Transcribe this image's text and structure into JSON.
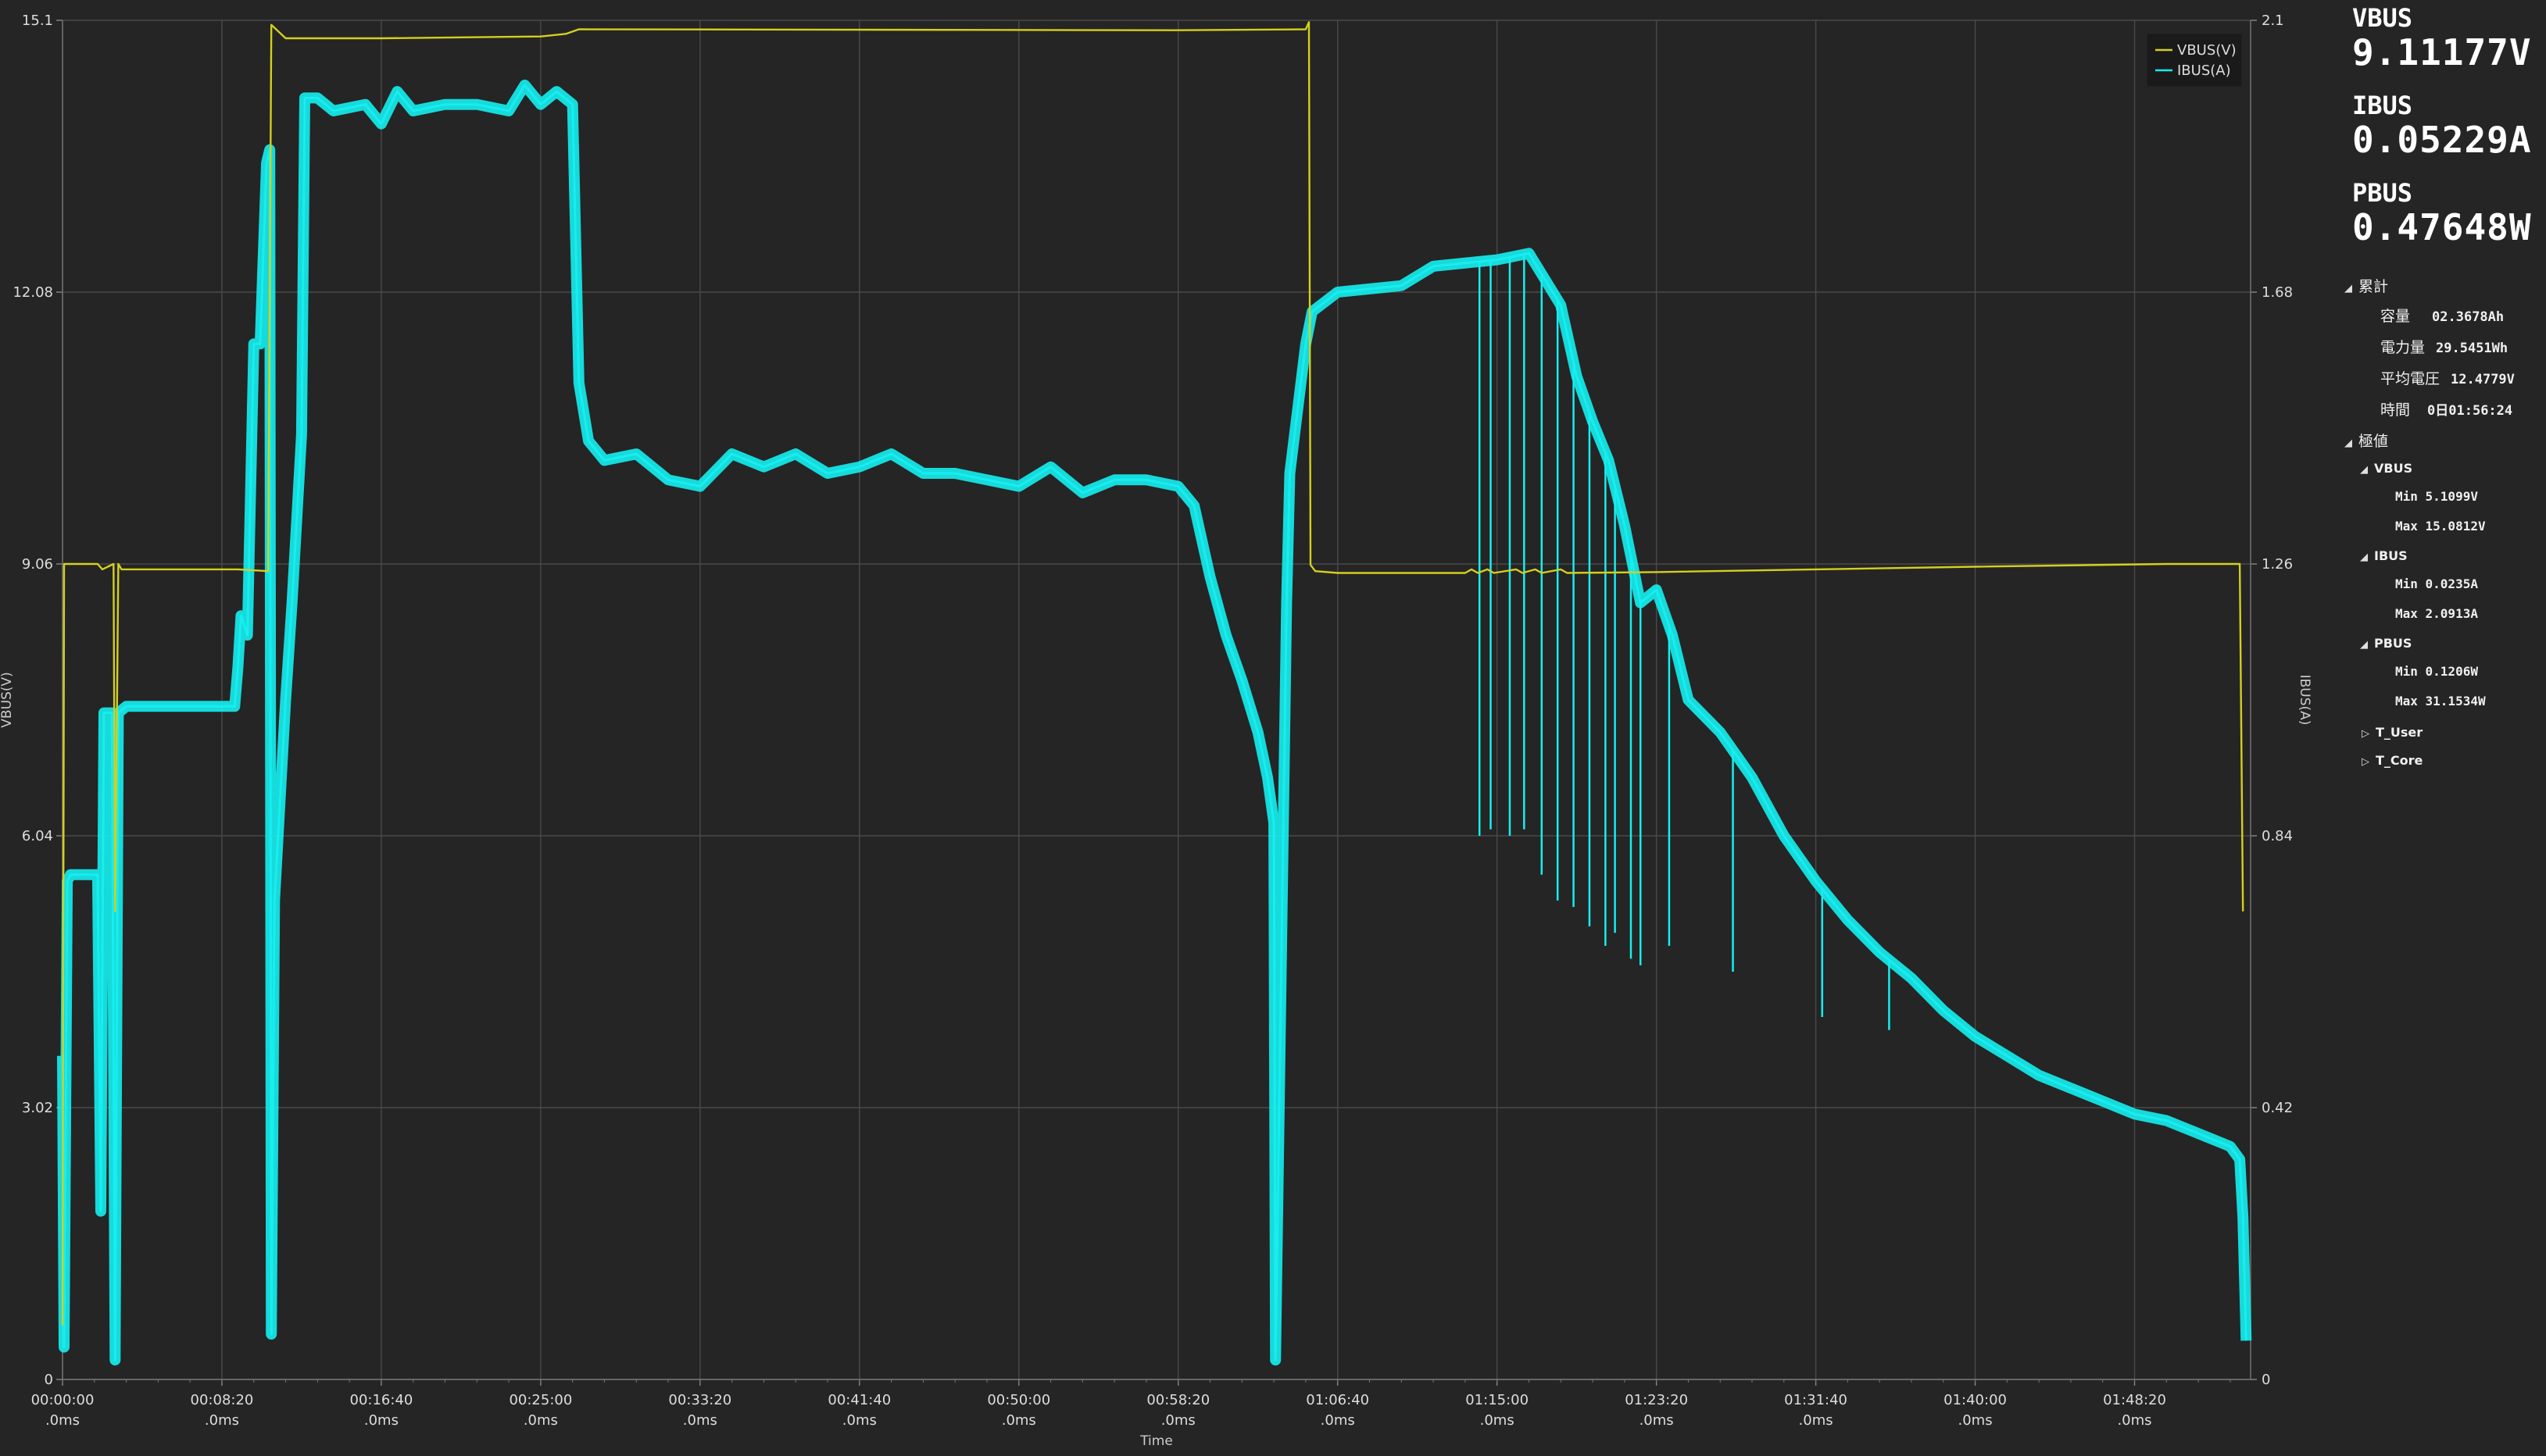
{
  "chart_data": {
    "type": "line",
    "xlabel": "Time",
    "ylabel_left": "VBUS(V)",
    "ylabel_right": "IBUS(A)",
    "x_unit": "seconds",
    "xlim_seconds": [
      0,
      6864
    ],
    "x_ticks": [
      {
        "t": 0,
        "label": "00:00:00",
        "sub": ".0ms"
      },
      {
        "t": 500,
        "label": "00:08:20",
        "sub": ".0ms"
      },
      {
        "t": 1000,
        "label": "00:16:40",
        "sub": ".0ms"
      },
      {
        "t": 1500,
        "label": "00:25:00",
        "sub": ".0ms"
      },
      {
        "t": 2000,
        "label": "00:33:20",
        "sub": ".0ms"
      },
      {
        "t": 2500,
        "label": "00:41:40",
        "sub": ".0ms"
      },
      {
        "t": 3000,
        "label": "00:50:00",
        "sub": ".0ms"
      },
      {
        "t": 3500,
        "label": "00:58:20",
        "sub": ".0ms"
      },
      {
        "t": 4000,
        "label": "01:06:40",
        "sub": ".0ms"
      },
      {
        "t": 4500,
        "label": "01:15:00",
        "sub": ".0ms"
      },
      {
        "t": 5000,
        "label": "01:23:20",
        "sub": ".0ms"
      },
      {
        "t": 5500,
        "label": "01:31:40",
        "sub": ".0ms"
      },
      {
        "t": 6000,
        "label": "01:40:00",
        "sub": ".0ms"
      },
      {
        "t": 6500,
        "label": "01:48:20",
        "sub": ".0ms"
      }
    ],
    "ylim_left": [
      0,
      15.1
    ],
    "left_ticks": [
      "0",
      "3.02",
      "6.04",
      "9.06",
      "12.08",
      "15.1"
    ],
    "ylim_right": [
      0,
      2.1
    ],
    "right_ticks": [
      "0",
      "0.42",
      "0.84",
      "1.26",
      "1.68",
      "2.1"
    ],
    "grid": true,
    "legend_position": "top-right",
    "series": [
      {
        "name": "VBUS(V)",
        "axis": "left",
        "color": "#d4cf1e",
        "points": [
          [
            0,
            0.6
          ],
          [
            5,
            9.06
          ],
          [
            110,
            9.06
          ],
          [
            125,
            9.0
          ],
          [
            160,
            9.06
          ],
          [
            165,
            5.2
          ],
          [
            175,
            9.06
          ],
          [
            185,
            9.0
          ],
          [
            550,
            9.0
          ],
          [
            645,
            8.98
          ],
          [
            655,
            15.05
          ],
          [
            700,
            14.9
          ],
          [
            1000,
            14.9
          ],
          [
            1500,
            14.92
          ],
          [
            1580,
            14.95
          ],
          [
            1620,
            15.0
          ],
          [
            3500,
            14.99
          ],
          [
            3900,
            15.0
          ],
          [
            3910,
            15.08
          ],
          [
            3915,
            9.05
          ],
          [
            3930,
            8.98
          ],
          [
            4000,
            8.96
          ],
          [
            4400,
            8.96
          ],
          [
            4420,
            9.0
          ],
          [
            4440,
            8.96
          ],
          [
            4470,
            9.0
          ],
          [
            4490,
            8.96
          ],
          [
            4560,
            9.0
          ],
          [
            4580,
            8.96
          ],
          [
            4620,
            9.0
          ],
          [
            4640,
            8.96
          ],
          [
            4700,
            9.0
          ],
          [
            4720,
            8.96
          ],
          [
            5000,
            8.97
          ],
          [
            5500,
            9.0
          ],
          [
            6000,
            9.03
          ],
          [
            6600,
            9.06
          ],
          [
            6830,
            9.06
          ],
          [
            6840,
            5.2
          ]
        ]
      },
      {
        "name": "IBUS(A)",
        "axis": "right",
        "color": "#16eef0",
        "points": [
          [
            0,
            0.5
          ],
          [
            5,
            0.05
          ],
          [
            15,
            0.77
          ],
          [
            25,
            0.78
          ],
          [
            110,
            0.78
          ],
          [
            120,
            0.26
          ],
          [
            130,
            1.03
          ],
          [
            155,
            1.03
          ],
          [
            165,
            0.03
          ],
          [
            175,
            1.03
          ],
          [
            200,
            1.04
          ],
          [
            540,
            1.04
          ],
          [
            550,
            1.1
          ],
          [
            560,
            1.18
          ],
          [
            580,
            1.15
          ],
          [
            600,
            1.6
          ],
          [
            620,
            1.6
          ],
          [
            640,
            1.88
          ],
          [
            650,
            1.9
          ],
          [
            655,
            0.07
          ],
          [
            665,
            0.74
          ],
          [
            700,
            1.05
          ],
          [
            720,
            1.2
          ],
          [
            750,
            1.46
          ],
          [
            760,
            1.98
          ],
          [
            800,
            1.98
          ],
          [
            850,
            1.96
          ],
          [
            950,
            1.97
          ],
          [
            1000,
            1.94
          ],
          [
            1050,
            1.99
          ],
          [
            1100,
            1.96
          ],
          [
            1200,
            1.97
          ],
          [
            1300,
            1.97
          ],
          [
            1400,
            1.96
          ],
          [
            1450,
            2.0
          ],
          [
            1500,
            1.97
          ],
          [
            1550,
            1.99
          ],
          [
            1600,
            1.97
          ],
          [
            1620,
            1.54
          ],
          [
            1650,
            1.45
          ],
          [
            1700,
            1.42
          ],
          [
            1800,
            1.43
          ],
          [
            1900,
            1.39
          ],
          [
            2000,
            1.38
          ],
          [
            2100,
            1.43
          ],
          [
            2200,
            1.41
          ],
          [
            2300,
            1.43
          ],
          [
            2400,
            1.4
          ],
          [
            2500,
            1.41
          ],
          [
            2600,
            1.43
          ],
          [
            2700,
            1.4
          ],
          [
            2800,
            1.4
          ],
          [
            2900,
            1.39
          ],
          [
            3000,
            1.38
          ],
          [
            3100,
            1.41
          ],
          [
            3200,
            1.37
          ],
          [
            3300,
            1.39
          ],
          [
            3400,
            1.39
          ],
          [
            3500,
            1.38
          ],
          [
            3550,
            1.35
          ],
          [
            3600,
            1.24
          ],
          [
            3650,
            1.15
          ],
          [
            3700,
            1.08
          ],
          [
            3750,
            1.0
          ],
          [
            3780,
            0.93
          ],
          [
            3800,
            0.86
          ],
          [
            3805,
            0.03
          ],
          [
            3840,
            1.2
          ],
          [
            3850,
            1.4
          ],
          [
            3900,
            1.6
          ],
          [
            3920,
            1.65
          ],
          [
            4000,
            1.68
          ],
          [
            4200,
            1.69
          ],
          [
            4300,
            1.72
          ],
          [
            4500,
            1.73
          ],
          [
            4600,
            1.74
          ],
          [
            4700,
            1.66
          ],
          [
            4750,
            1.55
          ],
          [
            4800,
            1.48
          ],
          [
            4850,
            1.42
          ],
          [
            4900,
            1.32
          ],
          [
            4950,
            1.2
          ],
          [
            5000,
            1.22
          ],
          [
            5050,
            1.15
          ],
          [
            5100,
            1.05
          ],
          [
            5200,
            1.0
          ],
          [
            5300,
            0.93
          ],
          [
            5400,
            0.84
          ],
          [
            5500,
            0.77
          ],
          [
            5600,
            0.71
          ],
          [
            5700,
            0.66
          ],
          [
            5800,
            0.62
          ],
          [
            5900,
            0.57
          ],
          [
            6000,
            0.53
          ],
          [
            6100,
            0.5
          ],
          [
            6200,
            0.47
          ],
          [
            6300,
            0.45
          ],
          [
            6400,
            0.43
          ],
          [
            6500,
            0.41
          ],
          [
            6600,
            0.4
          ],
          [
            6700,
            0.38
          ],
          [
            6800,
            0.36
          ],
          [
            6830,
            0.34
          ],
          [
            6840,
            0.25
          ],
          [
            6850,
            0.06
          ]
        ],
        "spikes": [
          [
            4445,
            0.84
          ],
          [
            4480,
            0.85
          ],
          [
            4540,
            0.84
          ],
          [
            4585,
            0.85
          ],
          [
            4640,
            0.78
          ],
          [
            4690,
            0.74
          ],
          [
            4740,
            0.73
          ],
          [
            4790,
            0.7
          ],
          [
            4840,
            0.67
          ],
          [
            4870,
            0.69
          ],
          [
            4920,
            0.65
          ],
          [
            4950,
            0.64
          ],
          [
            5040,
            0.67
          ],
          [
            5240,
            0.63
          ],
          [
            5520,
            0.56
          ],
          [
            5730,
            0.54
          ]
        ]
      }
    ]
  },
  "readouts": {
    "vbus_label": "VBUS",
    "vbus_value": "9.11177V",
    "ibus_label": "IBUS",
    "ibus_value": "0.05229A",
    "pbus_label": "PBUS",
    "pbus_value": "0.47648W"
  },
  "tree": {
    "cumulative_label": "累計",
    "capacity_label": "容量",
    "capacity_value": "02.3678Ah",
    "energy_label": "電力量",
    "energy_value": "29.5451Wh",
    "avg_voltage_label": "平均電圧",
    "avg_voltage_value": "12.4779V",
    "time_label": "時間",
    "time_value": "0日01:56:24",
    "extremes_label": "極値",
    "vbus_group": "VBUS",
    "vbus_min": "Min 5.1099V",
    "vbus_max": "Max 15.0812V",
    "ibus_group": "IBUS",
    "ibus_min": "Min 0.0235A",
    "ibus_max": "Max 2.0913A",
    "pbus_group": "PBUS",
    "pbus_min": "Min 0.1206W",
    "pbus_max": "Max 31.1534W",
    "t_user": "T_User",
    "t_core": "T_Core"
  }
}
